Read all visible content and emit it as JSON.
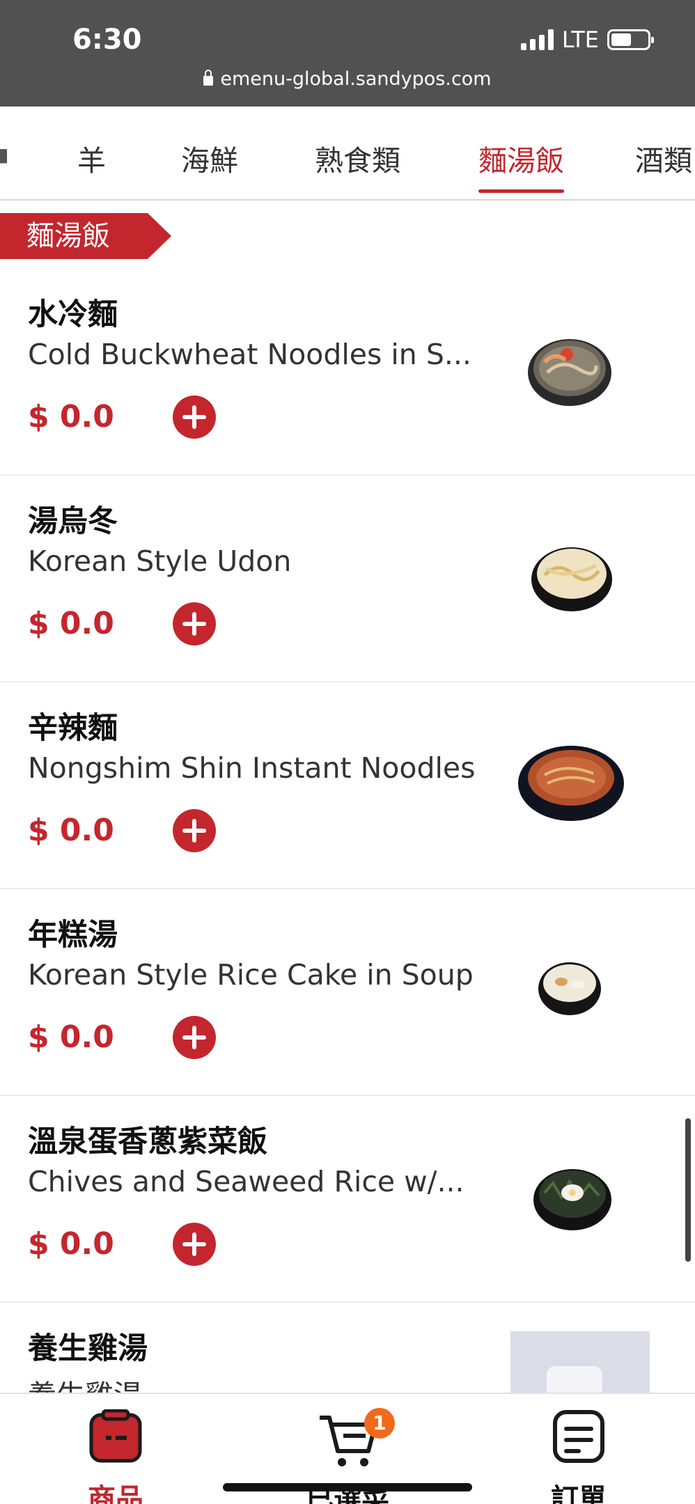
{
  "status_bar": {
    "time": "6:30",
    "network": "LTE",
    "url": "emenu-global.sandypos.com"
  },
  "category_tabs": [
    {
      "label": "羊",
      "active": false
    },
    {
      "label": "海鮮",
      "active": false
    },
    {
      "label": "熟食類",
      "active": false
    },
    {
      "label": "麵湯飯",
      "active": true
    },
    {
      "label": "酒類",
      "active": false
    }
  ],
  "section_title": "麵湯飯",
  "items": [
    {
      "name": "水冷麵",
      "description": "Cold Buckwheat Noodles in S...",
      "price": "$ 0.0"
    },
    {
      "name": "湯烏冬",
      "description": "Korean Style Udon",
      "price": "$ 0.0"
    },
    {
      "name": "辛辣麵",
      "description": "Nongshim Shin Instant Noodles",
      "price": "$ 0.0"
    },
    {
      "name": "年糕湯",
      "description": "Korean Style Rice Cake in Soup",
      "price": "$ 0.0"
    },
    {
      "name": "溫泉蛋香蔥紫菜飯",
      "description": "Chives and Seaweed Rice w/...",
      "price": "$ 0.0"
    },
    {
      "name": "養生雞湯",
      "description": "養生雞湯",
      "price": ""
    }
  ],
  "bottom_nav": {
    "products_label": "商品",
    "cart_label": "已選菜",
    "cart_badge": "1",
    "orders_label": "訂單"
  },
  "colors": {
    "accent": "#c4262d",
    "status_bar_bg": "#515151",
    "badge": "#f26a1b"
  }
}
